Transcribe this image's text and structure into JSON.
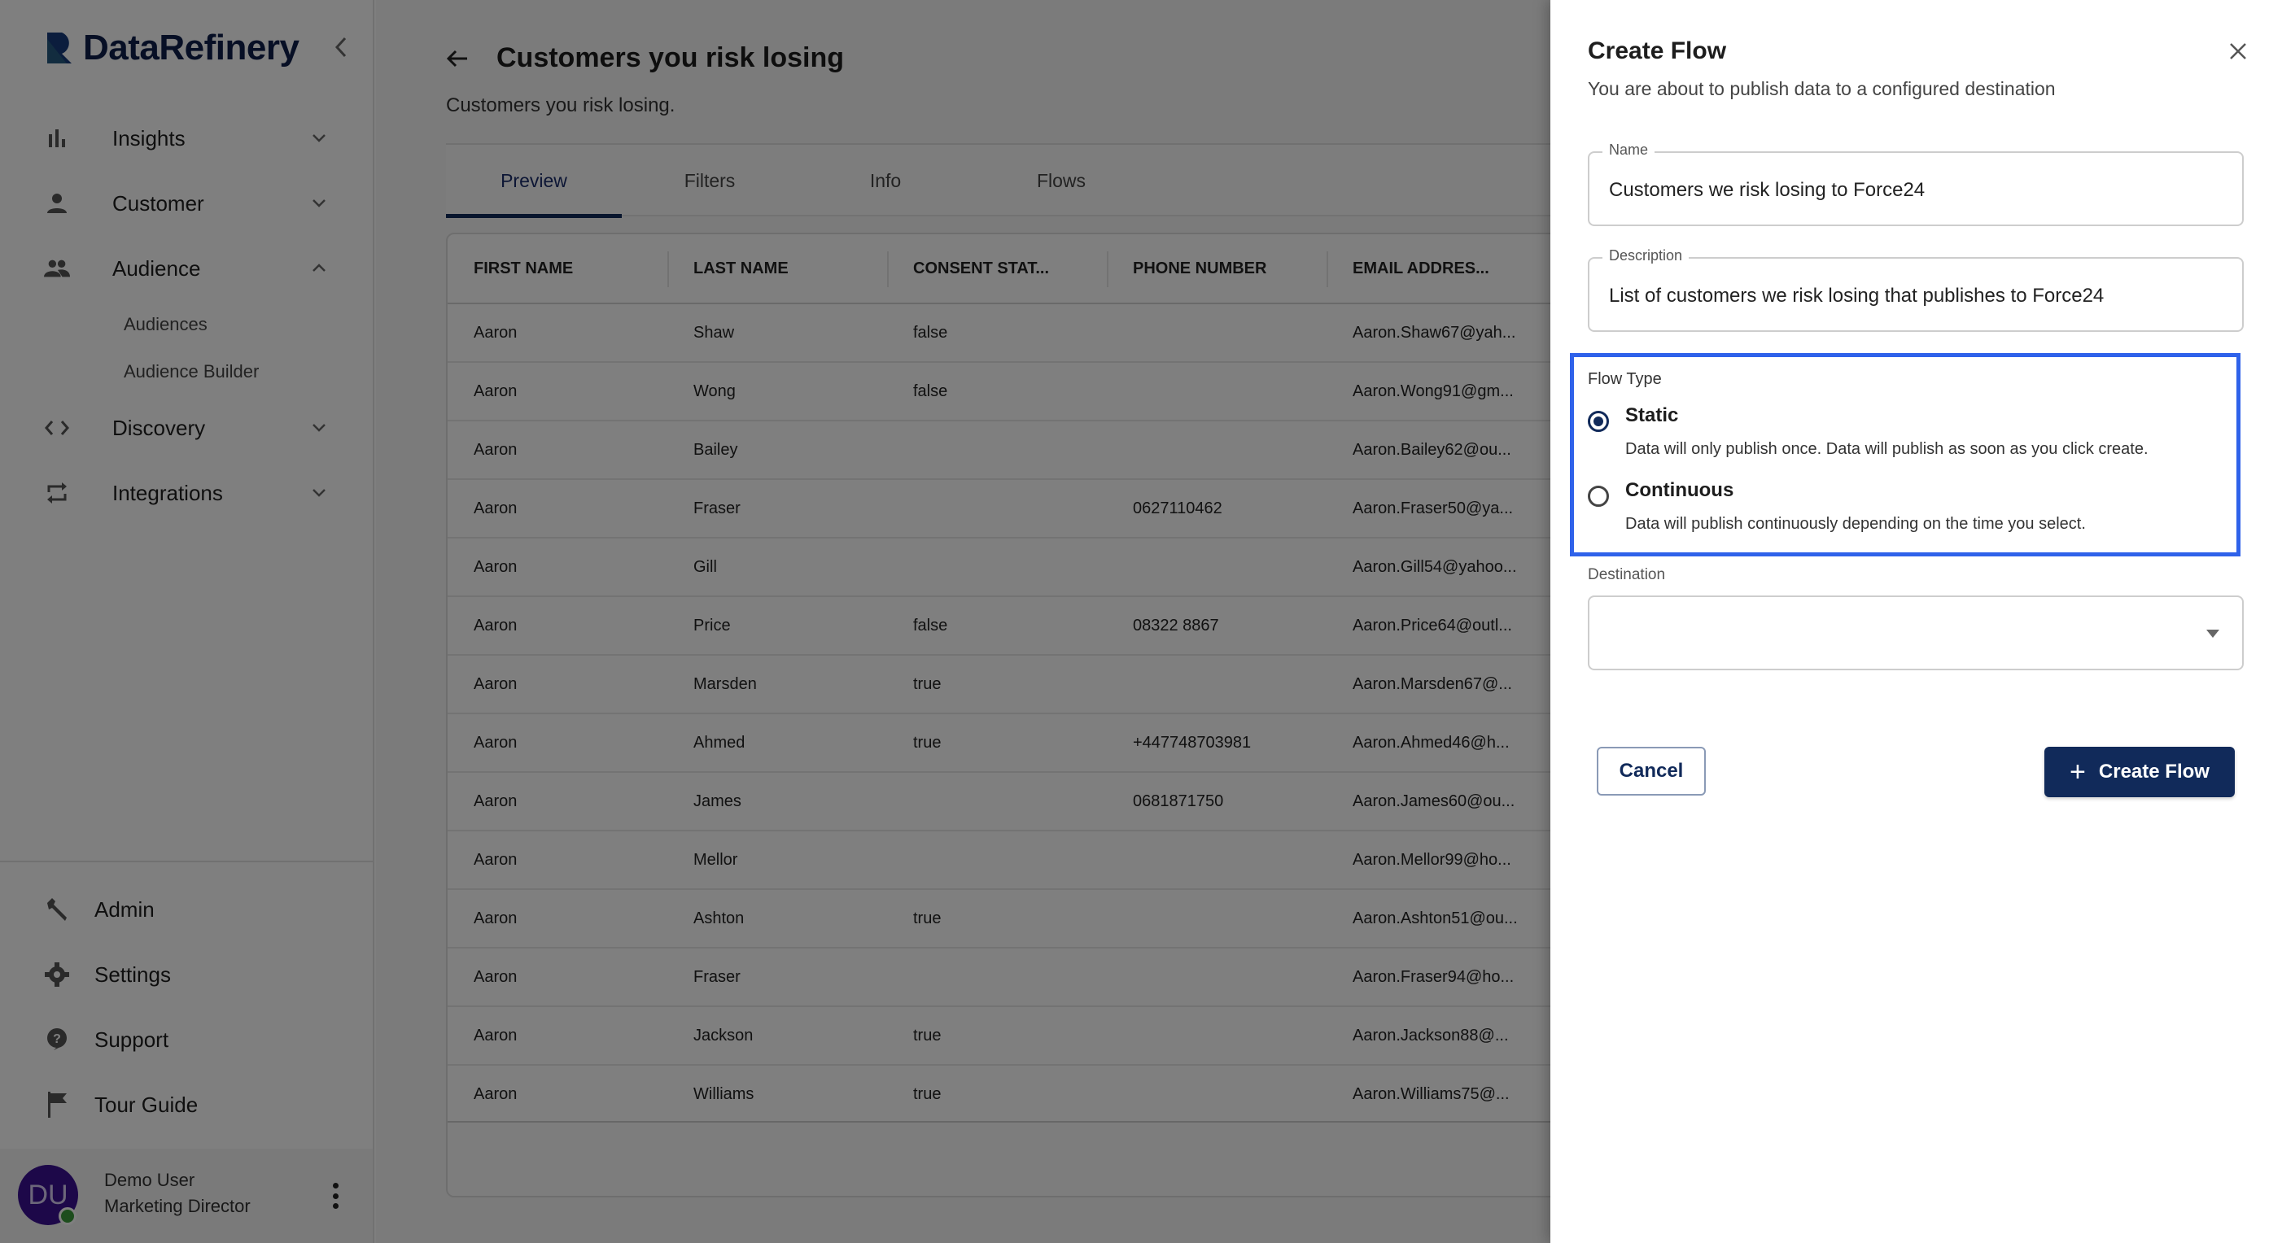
{
  "app": {
    "brand": "DataRefinery"
  },
  "sidebar": {
    "items": [
      {
        "label": "Insights",
        "icon": "bar-chart-icon",
        "expanded": false
      },
      {
        "label": "Customer",
        "icon": "person-icon",
        "expanded": false
      },
      {
        "label": "Audience",
        "icon": "people-icon",
        "expanded": true,
        "children": [
          {
            "label": "Audiences"
          },
          {
            "label": "Audience Builder"
          }
        ]
      },
      {
        "label": "Discovery",
        "icon": "code-icon",
        "expanded": false
      },
      {
        "label": "Integrations",
        "icon": "sync-arrows-icon",
        "expanded": false
      }
    ],
    "bottom_items": [
      {
        "label": "Admin",
        "icon": "wrench-icon"
      },
      {
        "label": "Settings",
        "icon": "gear-icon"
      },
      {
        "label": "Support",
        "icon": "help-icon"
      },
      {
        "label": "Tour Guide",
        "icon": "flag-icon"
      }
    ],
    "user": {
      "initials": "DU",
      "name": "Demo User",
      "role": "Marketing Director",
      "status": "online"
    }
  },
  "page": {
    "title": "Customers you risk losing",
    "subtitle": "Customers you risk losing.",
    "tabs": [
      {
        "label": "Preview",
        "active": true
      },
      {
        "label": "Filters",
        "active": false
      },
      {
        "label": "Info",
        "active": false
      },
      {
        "label": "Flows",
        "active": false
      }
    ]
  },
  "table": {
    "columns": [
      "FIRST NAME",
      "LAST NAME",
      "CONSENT STAT...",
      "PHONE NUMBER",
      "EMAIL ADDRES..."
    ],
    "rows": [
      [
        "Aaron",
        "Shaw",
        "false",
        "",
        "Aaron.Shaw67@yah..."
      ],
      [
        "Aaron",
        "Wong",
        "false",
        "",
        "Aaron.Wong91@gm..."
      ],
      [
        "Aaron",
        "Bailey",
        "",
        "",
        "Aaron.Bailey62@ou..."
      ],
      [
        "Aaron",
        "Fraser",
        "",
        "0627110462",
        "Aaron.Fraser50@ya..."
      ],
      [
        "Aaron",
        "Gill",
        "",
        "",
        "Aaron.Gill54@yahoo..."
      ],
      [
        "Aaron",
        "Price",
        "false",
        "08322 8867",
        "Aaron.Price64@outl..."
      ],
      [
        "Aaron",
        "Marsden",
        "true",
        "",
        "Aaron.Marsden67@..."
      ],
      [
        "Aaron",
        "Ahmed",
        "true",
        "+447748703981",
        "Aaron.Ahmed46@h..."
      ],
      [
        "Aaron",
        "James",
        "",
        "0681871750",
        "Aaron.James60@ou..."
      ],
      [
        "Aaron",
        "Mellor",
        "",
        "",
        "Aaron.Mellor99@ho..."
      ],
      [
        "Aaron",
        "Ashton",
        "true",
        "",
        "Aaron.Ashton51@ou..."
      ],
      [
        "Aaron",
        "Fraser",
        "",
        "",
        "Aaron.Fraser94@ho..."
      ],
      [
        "Aaron",
        "Jackson",
        "true",
        "",
        "Aaron.Jackson88@..."
      ],
      [
        "Aaron",
        "Williams",
        "true",
        "",
        "Aaron.Williams75@..."
      ]
    ]
  },
  "drawer": {
    "title": "Create Flow",
    "subtitle": "You are about to publish data to a configured destination",
    "name_label": "Name",
    "name_value": "Customers we risk losing to Force24",
    "description_label": "Description",
    "description_value": "List of customers we risk losing that publishes to Force24",
    "flow_type_label": "Flow Type",
    "flow_types": [
      {
        "title": "Static",
        "description": "Data will only publish once. Data will publish as soon as you click create.",
        "selected": true
      },
      {
        "title": "Continuous",
        "description": "Data will publish continuously depending on the time you select.",
        "selected": false
      }
    ],
    "destination_label": "Destination",
    "destination_value": "",
    "cancel_label": "Cancel",
    "create_label": "Create Flow",
    "colors": {
      "primary": "#112a5a",
      "highlight": "#2f62ea"
    }
  }
}
